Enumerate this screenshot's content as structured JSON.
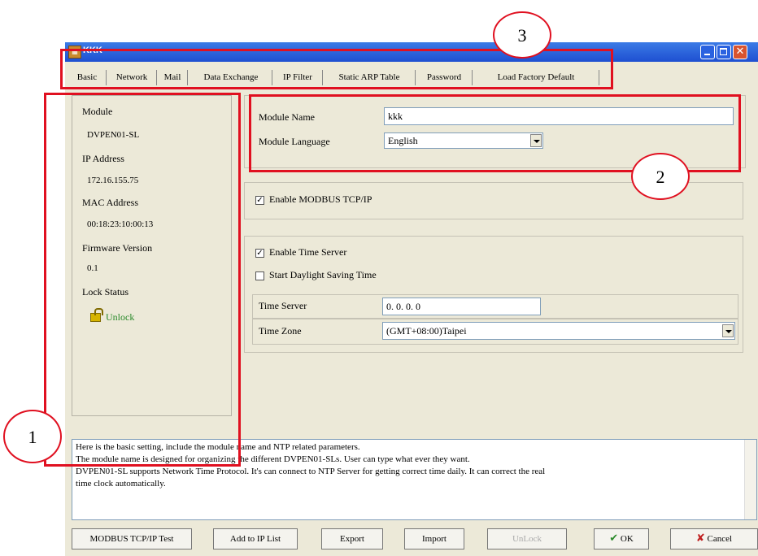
{
  "window": {
    "title": "KKK",
    "app_icon": "app-icon"
  },
  "tabs": [
    "Basic",
    "Network",
    "Mail",
    "Data Exchange",
    "IP Filter",
    "Static ARP Table",
    "Password",
    "Load Factory Default"
  ],
  "left_panel": {
    "module_label": "Module",
    "module_value": "DVPEN01-SL",
    "ip_label": "IP Address",
    "ip_value": "172.16.155.75",
    "mac_label": "MAC Address",
    "mac_value": "00:18:23:10:00:13",
    "fw_label": "Firmware Version",
    "fw_value": "0.1",
    "lock_label": "Lock Status",
    "lock_value": "Unlock"
  },
  "module": {
    "name_label": "Module Name",
    "name_value": "kkk",
    "lang_label": "Module Language",
    "lang_value": "English"
  },
  "modbus": {
    "enable_label": "Enable MODBUS TCP/IP",
    "checked": true
  },
  "time": {
    "enable_label": "Enable Time Server",
    "enable_checked": true,
    "dst_label": "Start Daylight Saving Time",
    "dst_checked": false,
    "server_label": "Time Server",
    "server_value": "0. 0. 0. 0",
    "zone_label": "Time Zone",
    "zone_value": "(GMT+08:00)Taipei"
  },
  "info": {
    "line1": "Here is the basic setting, include the module name and NTP related parameters.",
    "line2": "The module name is designed for organizing the different DVPEN01-SLs. User can type what ever they want.",
    "line3": "DVPEN01-SL supports Network Time Protocol. It's can connect to NTP Server for getting correct time daily. It can correct the real",
    "line4": "time clock automatically."
  },
  "buttons": {
    "modbus_test": "MODBUS TCP/IP Test",
    "add_ip": "Add to IP List",
    "export": "Export",
    "import": "Import",
    "unlock": "UnLock",
    "ok": "OK",
    "cancel": "Cancel"
  },
  "annotations": {
    "one": "1",
    "two": "2",
    "three": "3"
  },
  "colors": {
    "annotation": "#e01020",
    "titlebar": "#1e4fd1",
    "window_bg": "#ece9d8",
    "unlock_text": "#2a8a2a"
  }
}
